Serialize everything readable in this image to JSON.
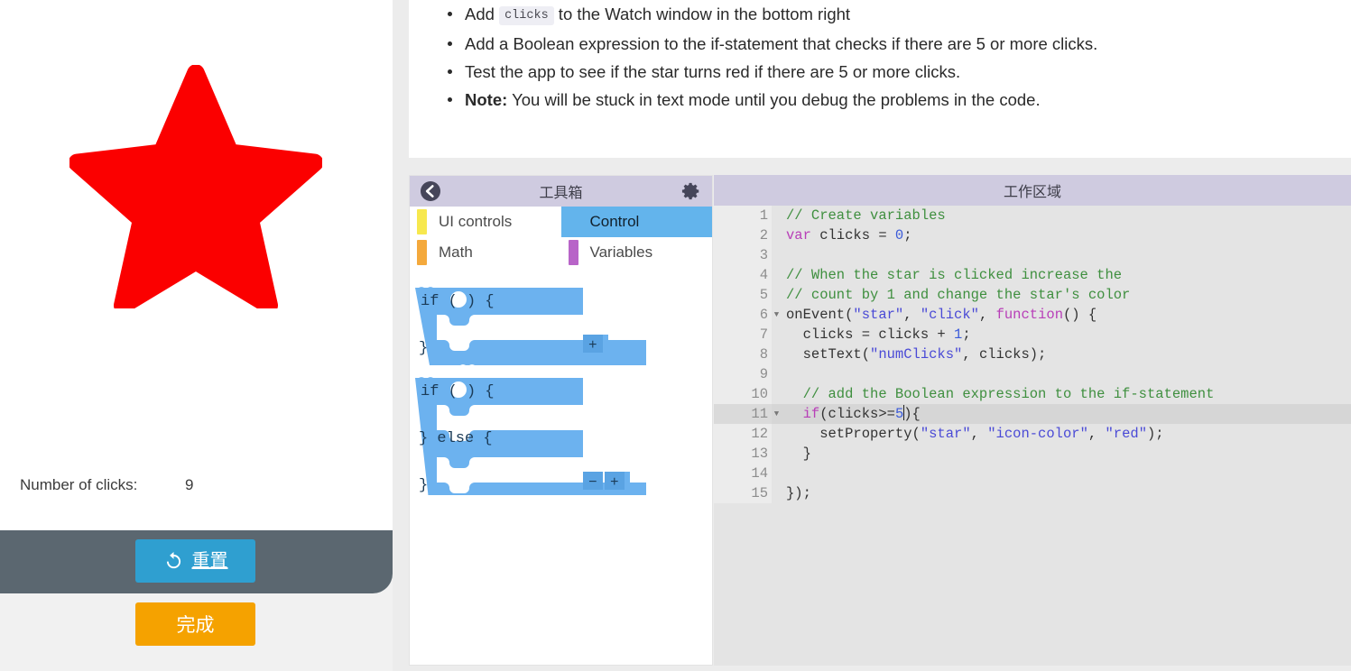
{
  "app": {
    "star_color": "#fb0000",
    "star_name": "star",
    "clicks_label": "Number of clicks:",
    "clicks_value": "9",
    "reset_button": "重置",
    "reset_icon": "refresh-icon",
    "finish_button": "完成",
    "finish_color": "#f5a200",
    "reset_color": "#2f9fd0",
    "footer_color": "#5b6770"
  },
  "instructions": {
    "items": [
      {
        "prefix": "Add ",
        "code": "clicks",
        "suffix": " to the Watch window in the bottom right"
      },
      {
        "prefix": "Add a Boolean expression to the if-statement that checks if there are 5 or more clicks.",
        "code": "",
        "suffix": ""
      },
      {
        "prefix": "Test the app to see if the star turns red if there are 5 or more clicks.",
        "code": "",
        "suffix": ""
      },
      {
        "prefix": "",
        "bold": "Note:",
        "suffix": " You will be stuck in text mode until you debug the problems in the code."
      }
    ]
  },
  "toolbox": {
    "title": "工具箱",
    "back_icon": "back-arrow-icon",
    "gear_icon": "gear-icon",
    "categories": [
      {
        "label": "UI controls",
        "color": "#f7e84e",
        "selected": false
      },
      {
        "label": "Control",
        "color": "#63b4ec",
        "selected": true
      },
      {
        "label": "Math",
        "color": "#f4a93c",
        "selected": false
      },
      {
        "label": "Variables",
        "color": "#b864c8",
        "selected": false
      }
    ],
    "blocks": [
      {
        "name": "if-block",
        "text": "if ( ) {  }",
        "mutators": [
          "+"
        ]
      },
      {
        "name": "if-else-block",
        "text": "if ( ) {  } else {  }",
        "mutators": [
          "−",
          "+"
        ]
      }
    ],
    "block_color": "#6cb2ef"
  },
  "workspace": {
    "title": "工作区域",
    "active_line": 11,
    "lines": [
      {
        "n": "1",
        "fold": false,
        "tokens": [
          {
            "t": "// Create variables",
            "c": "tok-comment"
          }
        ]
      },
      {
        "n": "2",
        "fold": false,
        "tokens": [
          {
            "t": "var",
            "c": "tok-kw"
          },
          {
            "t": " clicks = ",
            "c": ""
          },
          {
            "t": "0",
            "c": "tok-num"
          },
          {
            "t": ";",
            "c": ""
          }
        ]
      },
      {
        "n": "3",
        "fold": false,
        "tokens": []
      },
      {
        "n": "4",
        "fold": false,
        "tokens": [
          {
            "t": "// When the star is clicked increase the",
            "c": "tok-comment"
          }
        ]
      },
      {
        "n": "5",
        "fold": false,
        "tokens": [
          {
            "t": "// count by 1 and change the star's color",
            "c": "tok-comment"
          }
        ]
      },
      {
        "n": "6",
        "fold": true,
        "tokens": [
          {
            "t": "onEvent(",
            "c": ""
          },
          {
            "t": "\"star\"",
            "c": "tok-str"
          },
          {
            "t": ", ",
            "c": ""
          },
          {
            "t": "\"click\"",
            "c": "tok-str"
          },
          {
            "t": ", ",
            "c": ""
          },
          {
            "t": "function",
            "c": "tok-kw"
          },
          {
            "t": "() {",
            "c": ""
          }
        ]
      },
      {
        "n": "7",
        "fold": false,
        "tokens": [
          {
            "t": "  clicks = clicks + ",
            "c": ""
          },
          {
            "t": "1",
            "c": "tok-num"
          },
          {
            "t": ";",
            "c": ""
          }
        ]
      },
      {
        "n": "8",
        "fold": false,
        "tokens": [
          {
            "t": "  setText(",
            "c": ""
          },
          {
            "t": "\"numClicks\"",
            "c": "tok-str"
          },
          {
            "t": ", clicks);",
            "c": ""
          }
        ]
      },
      {
        "n": "9",
        "fold": false,
        "tokens": []
      },
      {
        "n": "10",
        "fold": false,
        "tokens": [
          {
            "t": "  // add the Boolean expression to the if-statement",
            "c": "tok-comment"
          }
        ]
      },
      {
        "n": "11",
        "fold": true,
        "tokens": [
          {
            "t": "  ",
            "c": ""
          },
          {
            "t": "if",
            "c": "tok-kw"
          },
          {
            "t": "(clicks>=",
            "c": ""
          },
          {
            "t": "5",
            "c": "tok-num"
          },
          {
            "t": "CARET",
            "c": "caret"
          },
          {
            "t": "){",
            "c": ""
          }
        ]
      },
      {
        "n": "12",
        "fold": false,
        "tokens": [
          {
            "t": "    setProperty(",
            "c": ""
          },
          {
            "t": "\"star\"",
            "c": "tok-str"
          },
          {
            "t": ", ",
            "c": ""
          },
          {
            "t": "\"icon-color\"",
            "c": "tok-str"
          },
          {
            "t": ", ",
            "c": ""
          },
          {
            "t": "\"red\"",
            "c": "tok-str"
          },
          {
            "t": ");",
            "c": ""
          }
        ]
      },
      {
        "n": "13",
        "fold": false,
        "tokens": [
          {
            "t": "  }",
            "c": ""
          }
        ]
      },
      {
        "n": "14",
        "fold": false,
        "tokens": []
      },
      {
        "n": "15",
        "fold": false,
        "tokens": [
          {
            "t": "});",
            "c": ""
          }
        ]
      }
    ]
  },
  "handles": {
    "vertical_drag": "vertical-resize-handle",
    "top_drag": "horizontal-resize-handle-top",
    "bottom_drag": "horizontal-resize-handle-bottom"
  }
}
